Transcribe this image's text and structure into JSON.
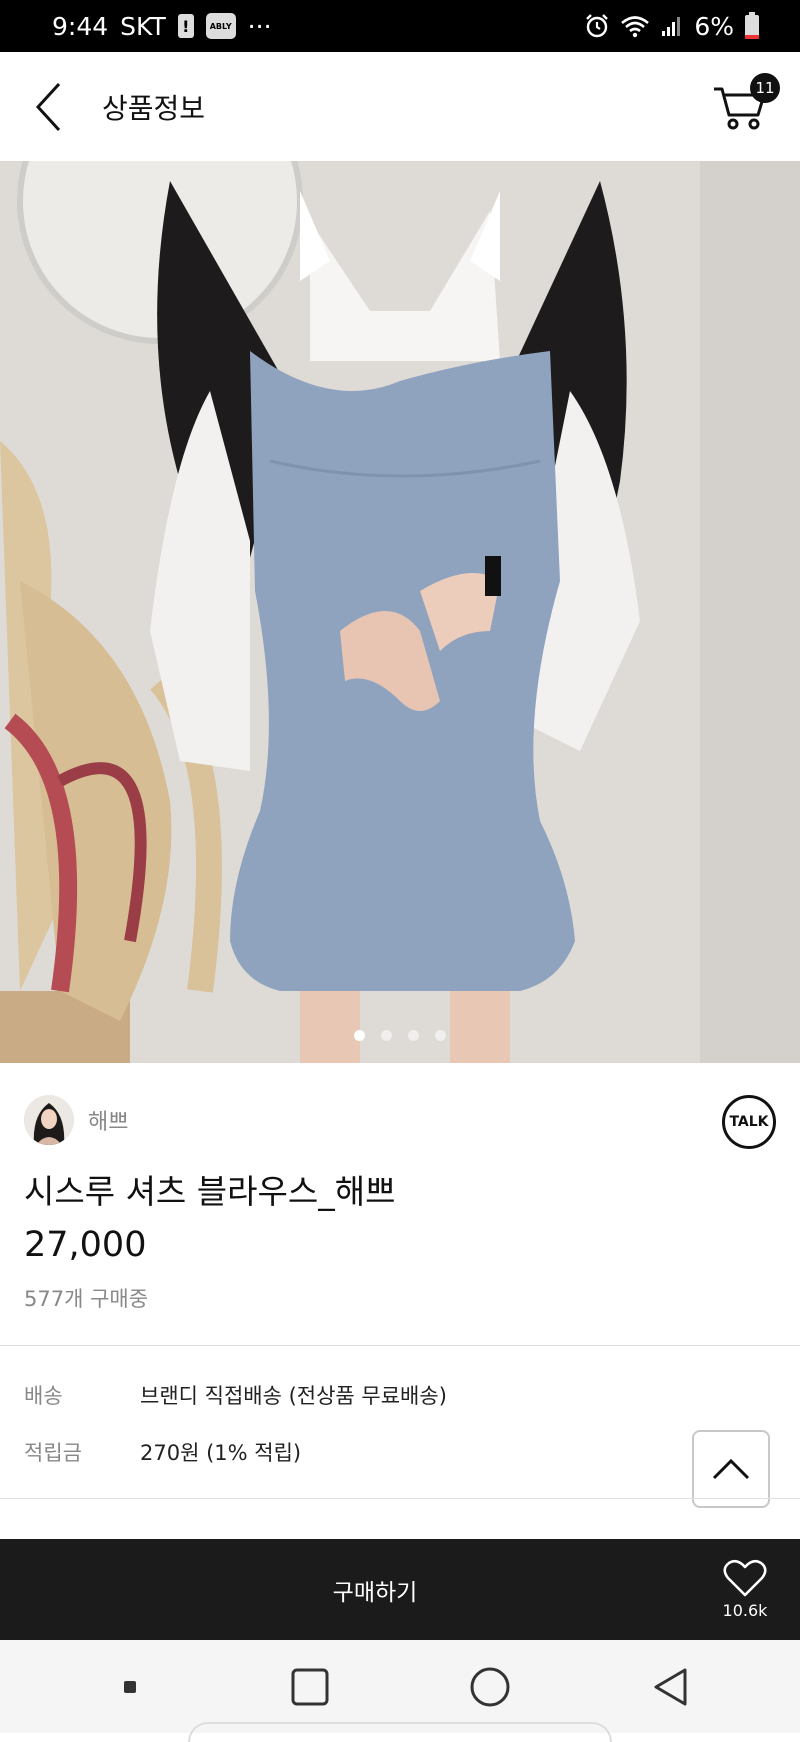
{
  "status_bar": {
    "time": "9:44",
    "carrier": "SKT",
    "app_badge": "ABLY",
    "more": "···",
    "battery": "6%"
  },
  "header": {
    "title": "상품정보",
    "cart_count": "11"
  },
  "hero": {
    "image_count": 4,
    "active_index": 0
  },
  "seller": {
    "name": "해쁘",
    "talk_label": "TALK"
  },
  "product": {
    "name": "시스루 셔츠 블라우스_해쁘",
    "price": "27,000",
    "buyers": "577개 구매중"
  },
  "info": {
    "shipping_label": "배송",
    "shipping_value": "브랜디 직접배송 (전상품 무료배송)",
    "points_label": "적립금",
    "points_value": "270원 (1% 적립)"
  },
  "bottom_bar": {
    "buy_label": "구매하기",
    "like_count": "10.6k"
  },
  "colors": {
    "dark_bar": "#1b1b1b",
    "dress_blue": "#8fa3bf"
  }
}
